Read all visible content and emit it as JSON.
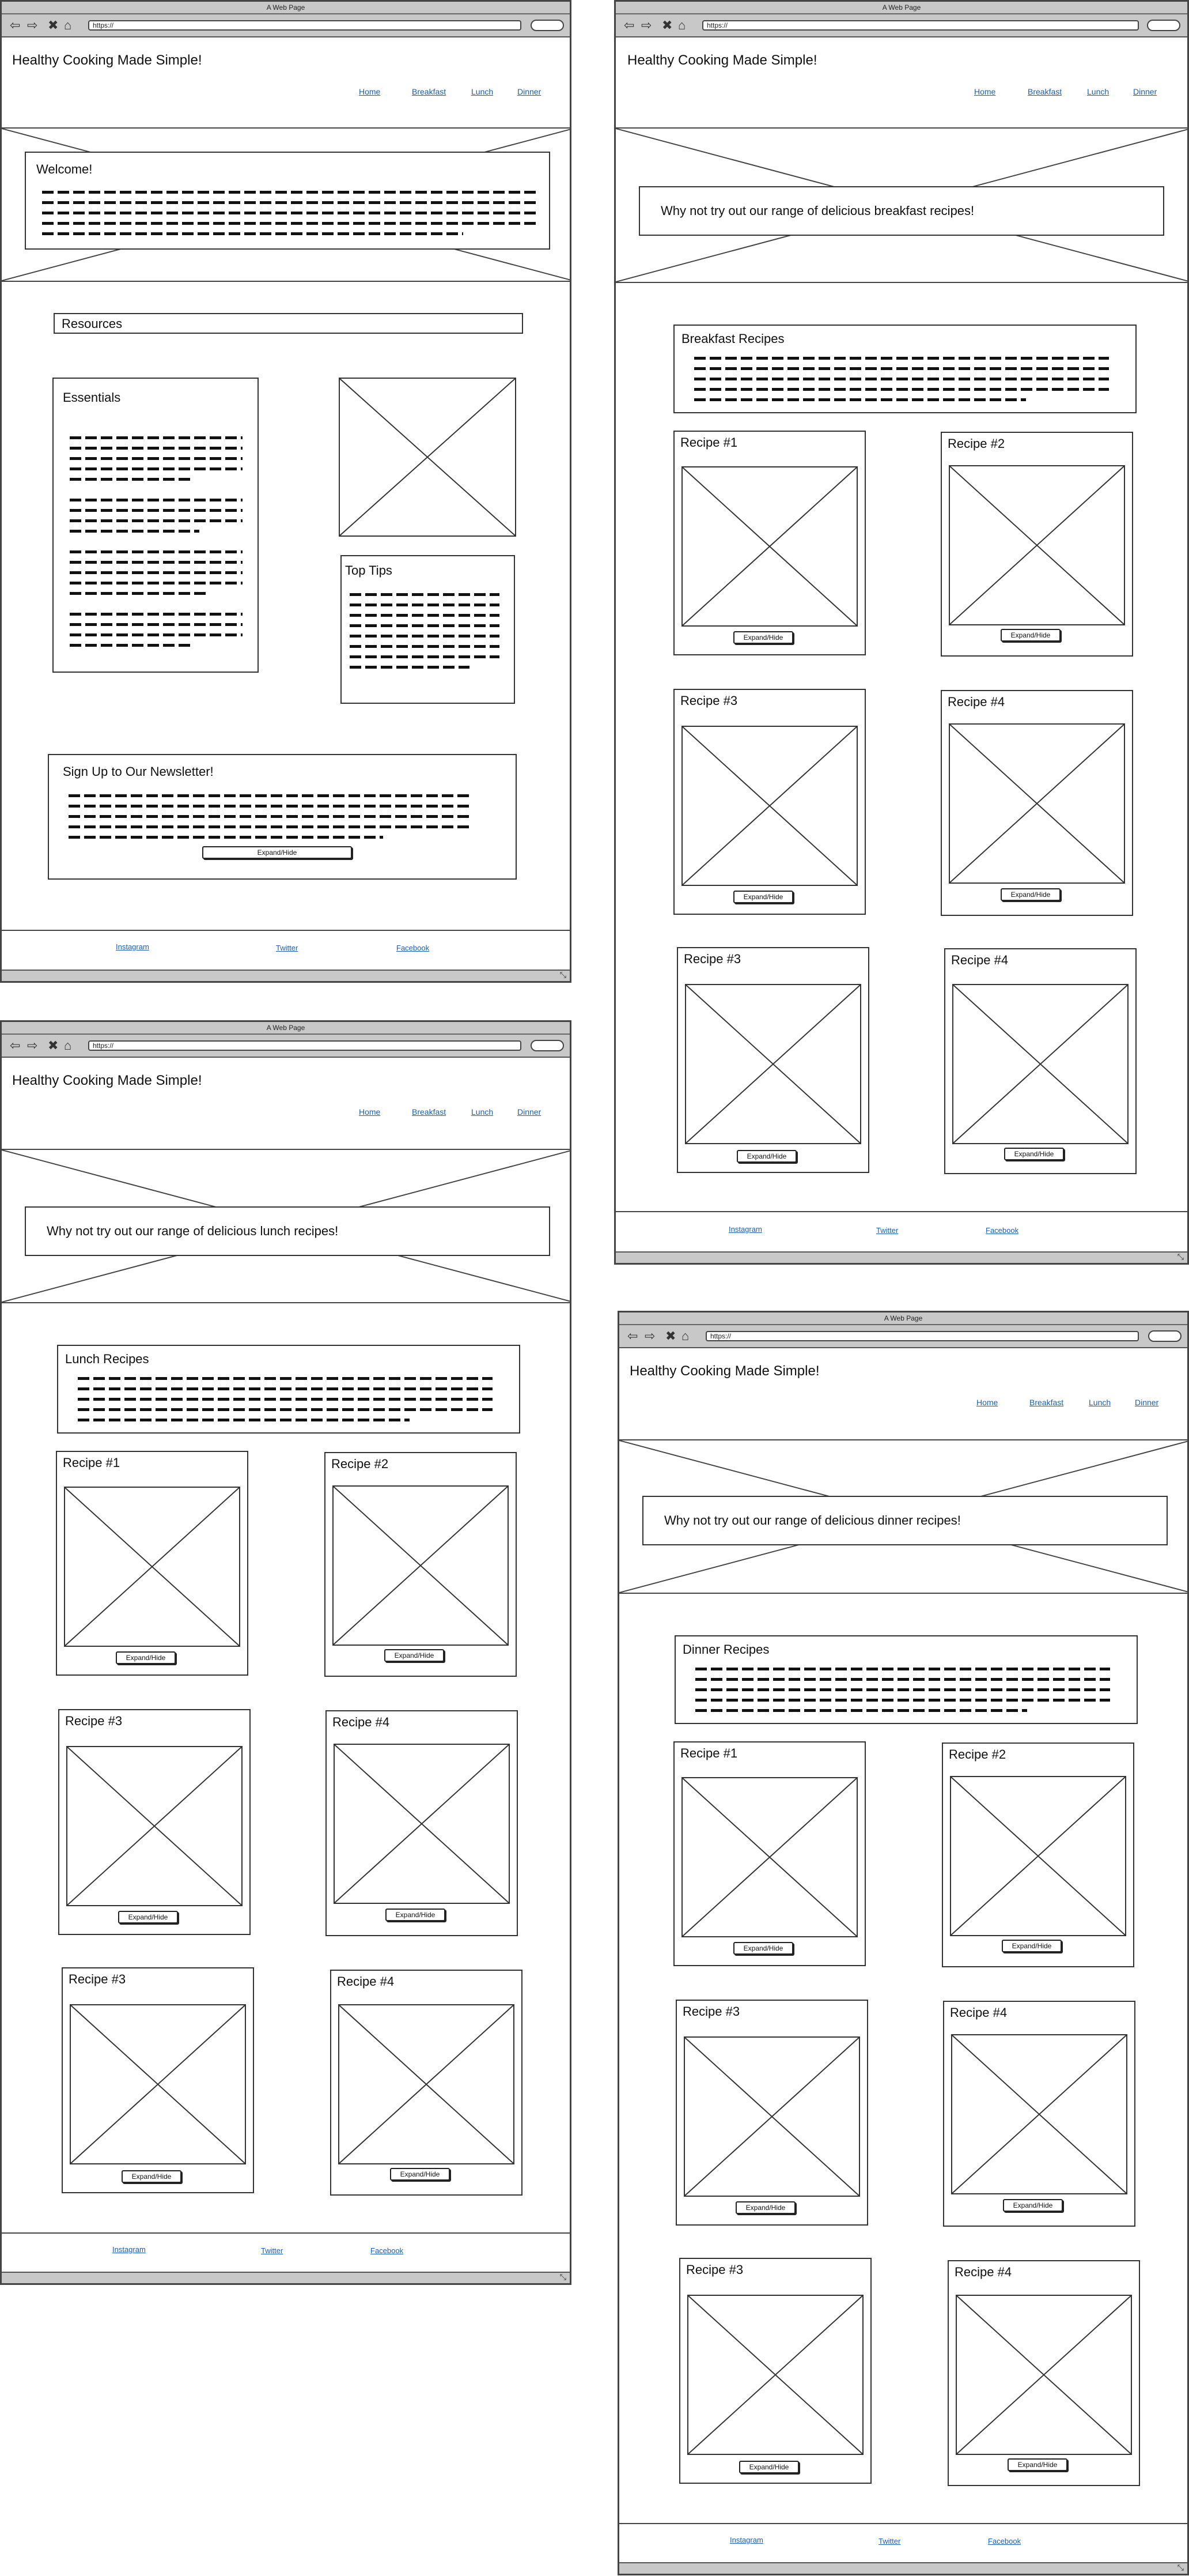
{
  "browser": {
    "title": "A Web Page",
    "url": "https://",
    "icons": [
      "back-icon",
      "forward-icon",
      "close-icon",
      "home-icon"
    ]
  },
  "site": {
    "title": "Healthy Cooking Made Simple!",
    "nav": [
      "Home",
      "Breakfast",
      "Lunch",
      "Dinner"
    ],
    "footer": [
      "Instagram",
      "Twitter",
      "Facebook"
    ]
  },
  "home": {
    "welcome_title": "Welcome!",
    "resources_title": "Resources",
    "essentials_title": "Essentials",
    "top_tips_title": "Top Tips",
    "newsletter_title": "Sign Up to Our Newsletter!",
    "expand_label": "Expand/Hide"
  },
  "breakfast": {
    "hero": "Why not try out our range of delicious breakfast recipes!",
    "section_title": "Breakfast Recipes",
    "recipes": [
      "Recipe #1",
      "Recipe #2",
      "Recipe #3",
      "Recipe #4",
      "Recipe #3",
      "Recipe #4"
    ],
    "expand_label": "Expand/Hide"
  },
  "lunch": {
    "hero": "Why not try out our range of delicious lunch recipes!",
    "section_title": "Lunch Recipes",
    "recipes": [
      "Recipe #1",
      "Recipe #2",
      "Recipe #3",
      "Recipe #4",
      "Recipe #3",
      "Recipe #4"
    ],
    "expand_label": "Expand/Hide"
  },
  "dinner": {
    "hero": "Why not try out our range of delicious dinner recipes!",
    "section_title": "Dinner Recipes",
    "recipes": [
      "Recipe #1",
      "Recipe #2",
      "Recipe #3",
      "Recipe #4",
      "Recipe #3",
      "Recipe #4"
    ],
    "expand_label": "Expand/Hide"
  }
}
